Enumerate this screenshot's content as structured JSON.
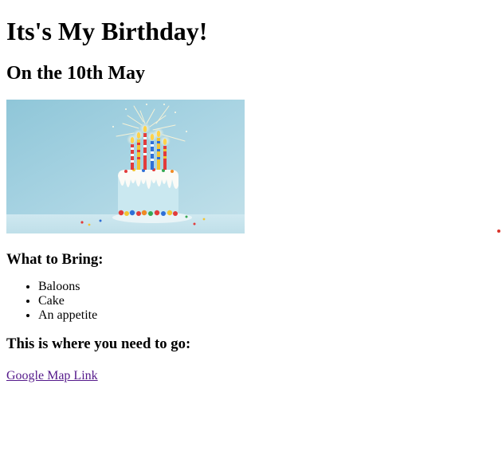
{
  "heading": "Its's My Birthday!",
  "date_heading": "On the 10th May",
  "image": {
    "description_icon": "birthday-cake-image",
    "background_color": "#a9d4e3",
    "cake_color": "#c9e6ef"
  },
  "bring": {
    "title": "What to Bring:",
    "items": [
      "Baloons",
      "Cake",
      "An appetite"
    ]
  },
  "directions": {
    "title": "This is where you need to go:",
    "link_text": "Google Map Link"
  },
  "colors": {
    "visited_link": "#551a8b",
    "dot": "#d9342b"
  }
}
